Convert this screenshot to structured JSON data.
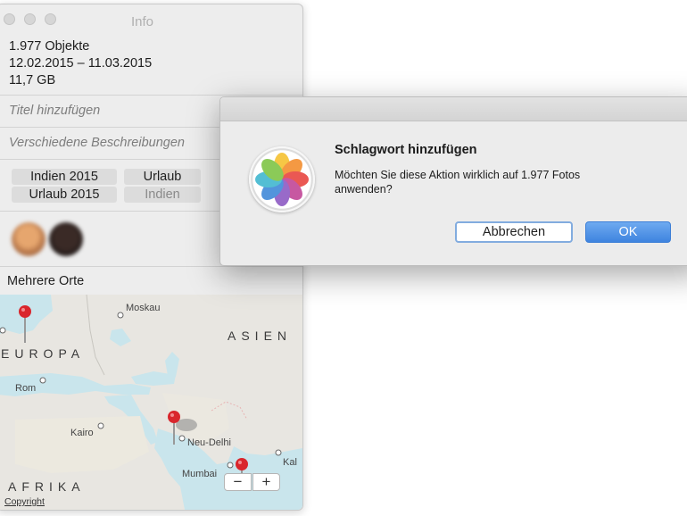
{
  "info_window": {
    "title": "Info",
    "count": "1.977 Objekte",
    "date_range": "12.02.2015 – 11.03.2015",
    "size": "11,7 GB",
    "title_placeholder": "Titel hinzufügen",
    "description_placeholder": "Verschiedene Beschreibungen",
    "keywords": [
      "Indien 2015",
      "Urlaub",
      "Urlaub 2015",
      "Indien"
    ],
    "places_label": "Mehrere Orte",
    "map": {
      "labels": [
        "Moskau",
        "Rom",
        "Kairo",
        "Neu-Delhi",
        "Mumbai",
        "Kal"
      ],
      "regions": [
        "EUROPA",
        "ASIEN",
        "AFRIKA"
      ],
      "zoom_out": "−",
      "zoom_in": "+",
      "copyright": "Copyright"
    }
  },
  "alert": {
    "title": "Schlagwort hinzufügen",
    "message": "Möchten Sie diese Aktion wirklich auf 1.977 Fotos anwenden?",
    "cancel_label": "Abbrechen",
    "ok_label": "OK"
  },
  "colors": {
    "accent": "#4a8de4",
    "pin": "#d9262c"
  }
}
